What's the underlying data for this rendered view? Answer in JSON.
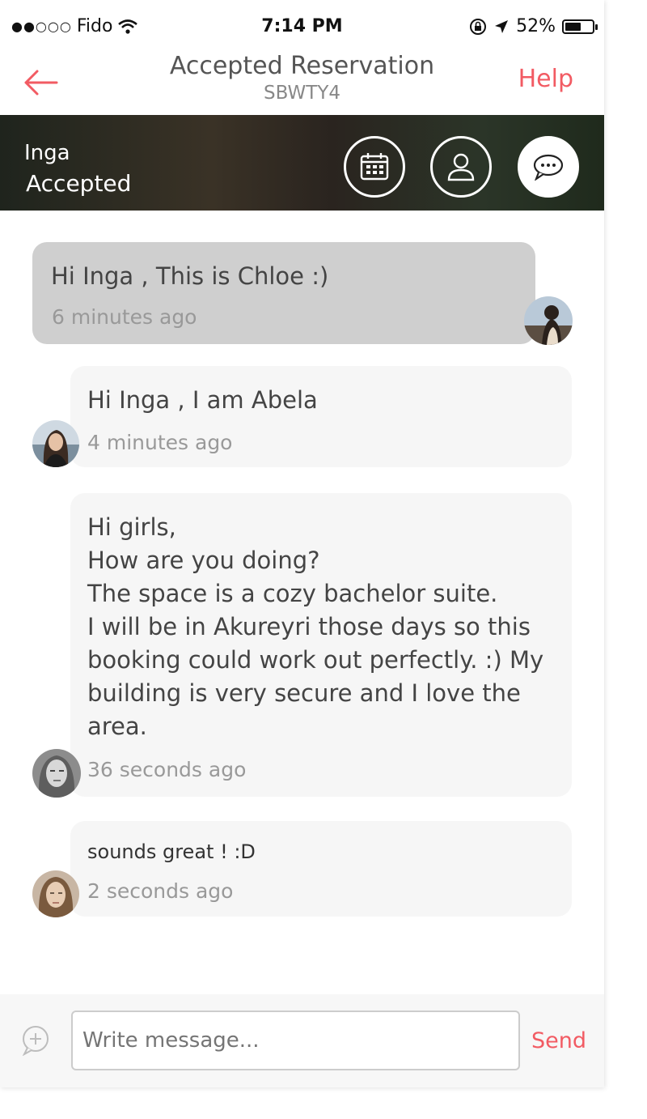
{
  "status": {
    "signal": "●●○○○",
    "carrier": "Fido",
    "time": "7:14 PM",
    "battery": "52%",
    "battery_level": 0.52
  },
  "nav": {
    "title": "Accepted Reservation",
    "code": "SBWTY4",
    "help": "Help"
  },
  "header": {
    "name": "Inga",
    "status": "Accepted"
  },
  "messages": [
    {
      "text": "Hi Inga , This is Chloe :)",
      "time": "6 minutes ago"
    },
    {
      "text": "Hi Inga ,  I  am Abela",
      "time": "4 minutes ago"
    },
    {
      "text": "Hi girls,\nHow are you doing?\nThe space is a cozy  bachelor  suite.\nI will be in Akureyri  those days so this\nbooking could work out perfectly. :) My\nbuilding is very secure and I love the\narea.",
      "time": "36 seconds ago"
    },
    {
      "text": "sounds great ! :D",
      "time": "2 seconds ago"
    }
  ],
  "composer": {
    "placeholder": "Write message...",
    "send": "Send"
  },
  "colors": {
    "accent": "#f25b63",
    "bubble_gray": "#cfcfcf",
    "bubble_light": "#f6f6f6"
  }
}
